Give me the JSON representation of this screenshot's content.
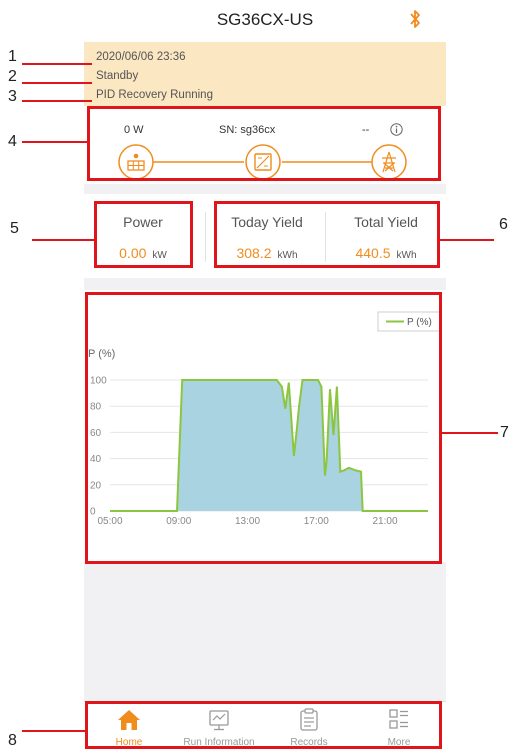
{
  "header": {
    "title": "SG36CX-US",
    "bluetooth_icon": "bluetooth-icon"
  },
  "status": {
    "datetime": "2020/06/06 23:36",
    "state": "Standby",
    "message": "PID Recovery Running"
  },
  "flow": {
    "pv_power": "0 W",
    "sn": "SN: sg36cx",
    "grid_value": "--",
    "info_icon": "info-icon"
  },
  "stats": {
    "power_label": "Power",
    "power_value": "0.00",
    "power_unit": "kW",
    "today_label": "Today Yield",
    "today_value": "308.2",
    "today_unit": "kWh",
    "total_label": "Total Yield",
    "total_value": "440.5",
    "total_unit": "kWh"
  },
  "chart_data": {
    "type": "area",
    "ylabel": "P (%)",
    "legend": "P (%)",
    "legend_position": "top-right",
    "x_ticks": [
      "05:00",
      "09:00",
      "13:00",
      "17:00",
      "21:00"
    ],
    "y_ticks": [
      "0",
      "20",
      "40",
      "60",
      "80",
      "100"
    ],
    "xlim": [
      5,
      23.5
    ],
    "ylim": [
      0,
      100
    ],
    "grid": true,
    "colors": {
      "line": "#8cc63f",
      "fill": "#a9d3e0"
    },
    "x": [
      5,
      8.9,
      9.2,
      14.7,
      15.0,
      15.2,
      15.4,
      15.7,
      15.85,
      16.0,
      16.2,
      17.1,
      17.3,
      17.5,
      17.6,
      17.8,
      18.0,
      18.2,
      18.4,
      18.6,
      18.9,
      19.3,
      19.6,
      19.7,
      20.0,
      23.5
    ],
    "y": [
      0,
      0,
      100,
      100,
      95,
      78,
      98,
      42,
      60,
      80,
      100,
      100,
      95,
      27,
      38,
      93,
      58,
      95,
      30,
      31,
      33,
      31,
      30,
      0,
      0,
      0
    ]
  },
  "nav": [
    {
      "label": "Home",
      "icon": "home-icon",
      "active": true
    },
    {
      "label": "Run Information",
      "icon": "run-information-icon",
      "active": false
    },
    {
      "label": "Records",
      "icon": "records-icon",
      "active": false
    },
    {
      "label": "More",
      "icon": "more-icon",
      "active": false
    }
  ],
  "callouts": {
    "c1": "1",
    "c2": "2",
    "c3": "3",
    "c4": "4",
    "c5": "5",
    "c6": "6",
    "c7": "7",
    "c8": "8"
  },
  "colors": {
    "accent": "#f08c1e",
    "highlight": "#e0151b",
    "status_bg": "#fbe7c2"
  }
}
